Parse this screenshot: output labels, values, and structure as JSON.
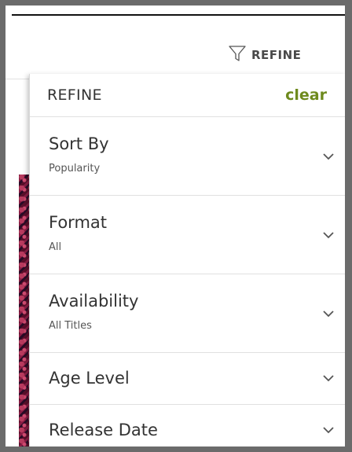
{
  "header": {
    "refine_button_label": "REFINE",
    "icon": "filter-funnel-icon"
  },
  "panel": {
    "title": "REFINE",
    "clear_label": "clear",
    "accent_color": "#6e8a1d",
    "filters": [
      {
        "name": "Sort By",
        "value": "Popularity"
      },
      {
        "name": "Format",
        "value": "All"
      },
      {
        "name": "Availability",
        "value": "All Titles"
      },
      {
        "name": "Age Level"
      },
      {
        "name": "Release Date"
      }
    ],
    "chevron_icon": "chevron-down-icon"
  }
}
